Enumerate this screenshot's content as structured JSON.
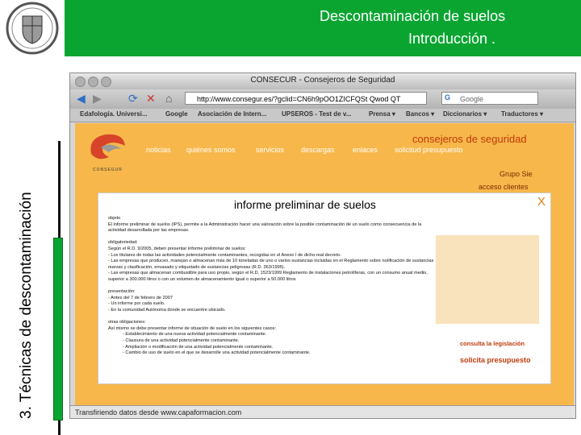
{
  "slide": {
    "title_line1": "Descontaminación de suelos",
    "title_line2": "Introducción    .",
    "side_label": "3.  Técnicas de descontaminación",
    "colors": {
      "header_green": "#0aa531",
      "site_orange": "#f7b74a",
      "site_accent": "#c0390b"
    }
  },
  "browser": {
    "window_title": "CONSECUR - Consejeros de Seguridad",
    "url": "http://www.consegur.es/?gclid=CN6h9pOO1ZICFQSt Qwod QT",
    "search_placeholder": "Google",
    "bookmarks": [
      "Edafología. Universi...",
      "Google",
      "Asociación de Intern...",
      "UPSEROS - Test de v...",
      "Prensa ▾",
      "Bancos ▾",
      "Diccionarios ▾",
      "Traductores ▾"
    ],
    "status": "Transfiriendo datos desde www.capaformacion.com"
  },
  "site": {
    "logo_text": "CONSEGUR",
    "tagline": "consejeros de seguridad",
    "menu": [
      "noticias",
      "quiénes somos",
      "servicios",
      "descargas",
      "enlaces",
      "solicitud presupuesto"
    ],
    "grupo": "Grupo Sie",
    "acceso": "acceso clientes"
  },
  "modal": {
    "title": "informe preliminar de suelos",
    "close": "X",
    "lines": [
      {
        "t": "objeto",
        "i": false
      },
      {
        "t": "El informe preliminar de suelos (IPS), permite a la Administración hacer una valoración sobre la posible contaminación de un suelo como consecuencia de la",
        "i": false
      },
      {
        "t": "actividad desarrollada por las empresas.",
        "i": false
      },
      {
        "t": "",
        "i": false
      },
      {
        "t": "obligatoriedad:",
        "i": false
      },
      {
        "t": "Según el R.D. 9/2005, deben presentar informe preliminar de suelos:",
        "i": false
      },
      {
        "t": "- Los titulares de todas las actividades potencialmente contaminantes, recogidas en el Anexo I de dicho real decreto.",
        "i": false
      },
      {
        "t": "- Las empresas que producen, manejan o almacenan más de 10 toneladas de uno o varios sustancias incluidas en el Reglamento sobre notificación de sustancias",
        "i": false
      },
      {
        "t": "  nuevas y clasificación, envasado y etiquetado de sustancias peligrosas (R.D. 363/1995).",
        "i": false
      },
      {
        "t": "- Las empresas que almacenan combustible para uso propio, según el R.D. 1523/1999 Reglamento de instalaciones petrolíferas, con un consumo anual medio,",
        "i": false
      },
      {
        "t": "  superior a 300.000 litros o con un volumen de almacenamiento igual o superior a 50.000 litros",
        "i": false
      },
      {
        "t": "",
        "i": false
      },
      {
        "t": "presentación:",
        "i": false
      },
      {
        "t": "- Antes del 7 de febrero de 2007",
        "i": false
      },
      {
        "t": "- Un informe por cada suelo.",
        "i": false
      },
      {
        "t": "- En la comunidad Autónoma donde se encuentre ubicado.",
        "i": false
      },
      {
        "t": "",
        "i": false
      },
      {
        "t": "otras obligaciones:",
        "i": false
      },
      {
        "t": "Así mismo se debe presentar informe de situación de suelo en los siguientes casos:",
        "i": false
      },
      {
        "t": "- Establecimiento de una nueva actividad potencialmente contaminante.",
        "i": true
      },
      {
        "t": "- Clausura de una actividad potencialmente contaminante.",
        "i": true
      },
      {
        "t": "- Ampliación o modificación de una actividad potencialmente contaminante.",
        "i": true
      },
      {
        "t": "- Cambio de uso de suelo en el que se desarrolle una actividad potencialmente contaminante.",
        "i": true
      }
    ],
    "link_legislacion": "consulta la legislación",
    "link_presupuesto": "solicita presupuesto"
  }
}
